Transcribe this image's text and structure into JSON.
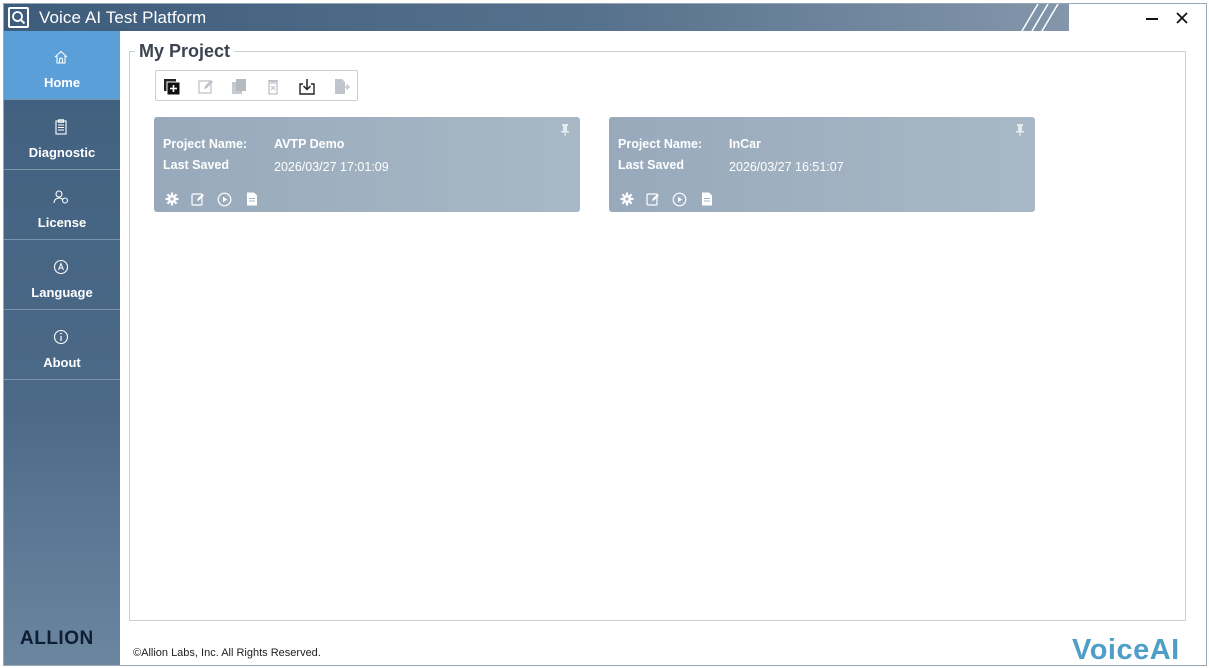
{
  "app": {
    "title": "Voice AI Test Platform"
  },
  "window_controls": {
    "minimize_icon": "minimize-icon",
    "close_icon": "close-icon"
  },
  "sidebar": {
    "items": [
      {
        "label": "Home",
        "icon": "home-icon",
        "active": true
      },
      {
        "label": "Diagnostic",
        "icon": "clipboard-icon",
        "active": false
      },
      {
        "label": "License",
        "icon": "license-icon",
        "active": false
      },
      {
        "label": "Language",
        "icon": "language-icon",
        "active": false
      },
      {
        "label": "About",
        "icon": "info-icon",
        "active": false
      }
    ],
    "logo": "ALLION"
  },
  "main": {
    "group_title": "My Project",
    "toolbar": [
      "add-project-icon",
      "edit-icon",
      "copy-icon",
      "delete-icon",
      "import-icon",
      "export-icon"
    ],
    "cards": [
      {
        "name_label": "Project Name:",
        "name_value": "AVTP Demo",
        "saved_label": "Last Saved",
        "saved_value": "2026/03/27 17:01:09"
      },
      {
        "name_label": "Project Name:",
        "name_value": "InCar",
        "saved_label": "Last Saved",
        "saved_value": "2026/03/27 16:51:07"
      }
    ]
  },
  "footer": {
    "copyright": "©Allion Labs, Inc. All Rights Reserved.",
    "brand": "VoiceAI"
  },
  "colors": {
    "titlebar": "#3d5c7b",
    "sidebar": "#4c6a88",
    "active_nav": "#5b9fd8",
    "card": "#a2b2c2",
    "brand_voiceai": "#4e9ec7"
  }
}
